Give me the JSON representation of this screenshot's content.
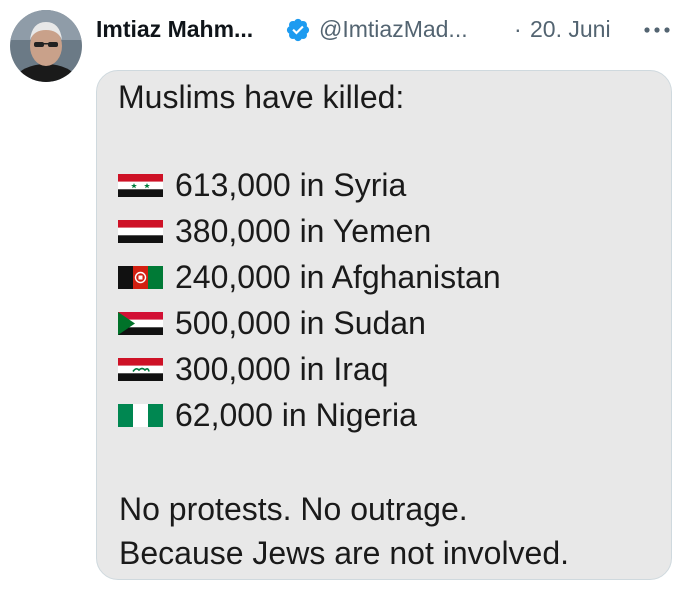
{
  "tweet": {
    "display_name": "Imtiaz Mahm...",
    "handle": "@ImtiazMad...",
    "separator": "·",
    "date": "20. Juni",
    "more_label": "•••",
    "verified_color": "#1d9bf0"
  },
  "image_text": {
    "heading": "Muslims have killed:",
    "items": [
      {
        "flag": "syria-flag-icon",
        "text": "613,000 in Syria"
      },
      {
        "flag": "yemen-flag-icon",
        "text": "380,000 in Yemen"
      },
      {
        "flag": "afghanistan-flag-icon",
        "text": "240,000 in Afghanistan"
      },
      {
        "flag": "sudan-flag-icon",
        "text": "500,000 in Sudan"
      },
      {
        "flag": "iraq-flag-icon",
        "text": "300,000 in Iraq"
      },
      {
        "flag": "nigeria-flag-icon",
        "text": "62,000 in Nigeria"
      }
    ],
    "closing_line_1": "No protests. No outrage.",
    "closing_line_2": "Because Jews are not involved."
  }
}
